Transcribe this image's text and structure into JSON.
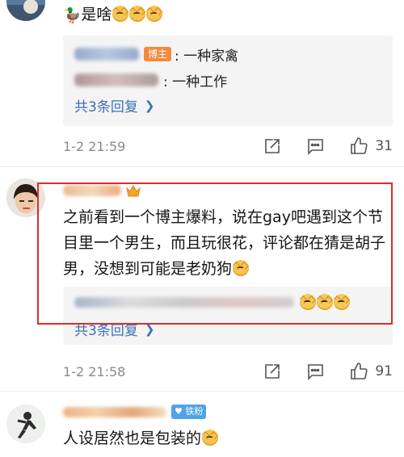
{
  "comment1": {
    "text": "是啥",
    "reply_box": {
      "reply1_badge": "博主",
      "reply1_text": ": 一种家禽",
      "reply2_text": ": 一种工作",
      "more_replies": "共3条回复"
    },
    "time": "1-2 21:59",
    "likes": "31"
  },
  "comment2": {
    "text": "之前看到一个博主爆料，说在gay吧遇到这个节目里一个男生，而且玩很花，评论都在猜是胡子男，没想到可能是老奶狗",
    "reply_box": {
      "more_replies": "共3条回复"
    },
    "time": "1-2 21:58",
    "likes": "91"
  },
  "comment3": {
    "badge": "铁粉",
    "text": "人设居然也是包装的"
  },
  "icons": {
    "share": "share-icon",
    "comment": "comment-icon",
    "like": "thumbs-up-icon",
    "chevron": "chevron-right-icon"
  },
  "colors": {
    "link_blue": "#3d6fb5",
    "badge_orange": "#f28a3d",
    "badge_blue": "#4fa3e8",
    "highlight_red": "#e02b2b"
  }
}
